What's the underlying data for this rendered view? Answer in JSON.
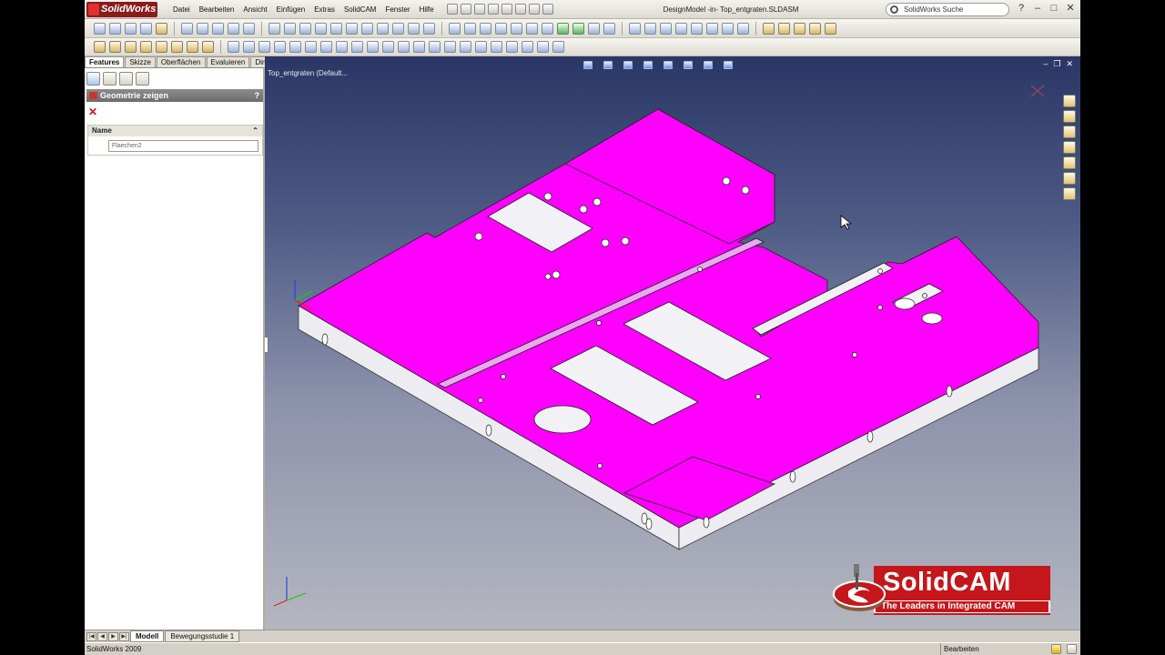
{
  "app": {
    "name": "SolidWorks",
    "document_title": "DesignModel -in- Top_entgraten.SLDASM"
  },
  "menu": {
    "items": [
      "Datei",
      "Bearbeiten",
      "Ansicht",
      "Einfügen",
      "Extras",
      "SolidCAM",
      "Fenster",
      "Hilfe"
    ]
  },
  "search": {
    "placeholder": "SolidWorks Suche"
  },
  "window_controls": {
    "minimize": "–",
    "restore": "□",
    "close": "✕",
    "help": "?"
  },
  "left_panel": {
    "tabs": [
      "Features",
      "Skizze",
      "Oberflächen",
      "Evaluieren",
      "DimXpert"
    ],
    "active_tab": "Features",
    "property_manager": {
      "title": "Geometrie zeigen",
      "help": "?",
      "close": "✕",
      "group_header": "Name",
      "group_chevron": "⌃",
      "selection_value": "Flaechen2"
    }
  },
  "viewport": {
    "tree_flyout": "Top_entgraten  (Default...",
    "ctrls": {
      "minimize": "–",
      "restore": "❐",
      "close": "✕"
    },
    "model_color": "#ff00ff",
    "model_side_color": "#e9e9ee"
  },
  "banner": {
    "name": "SolidCAM",
    "tagline": "The Leaders in Integrated CAM",
    "color": "#c4161b"
  },
  "bottom": {
    "tabs": [
      "Modell",
      "Bewegungsstudie 1"
    ],
    "active_tab": "Modell",
    "nav": [
      "|◀",
      "◀",
      "▶",
      "▶|"
    ]
  },
  "status": {
    "left": "SolidWorks 2009",
    "right": "Bearbeiten Teil"
  }
}
